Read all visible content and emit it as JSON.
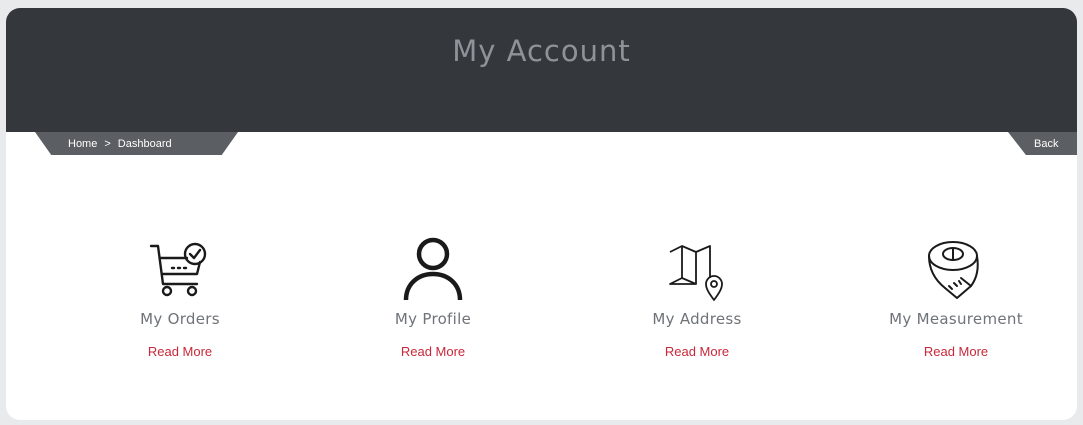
{
  "header": {
    "title": "My Account"
  },
  "breadcrumb": {
    "items": [
      "Home",
      "Dashboard"
    ],
    "separator": ">"
  },
  "nav": {
    "back_label": "Back"
  },
  "tiles": [
    {
      "label": "My Orders",
      "link": "Read More",
      "icon": "cart-check-icon"
    },
    {
      "label": "My Profile",
      "link": "Read More",
      "icon": "user-icon"
    },
    {
      "label": "My Address",
      "link": "Read More",
      "icon": "map-pin-icon"
    },
    {
      "label": "My Measurement",
      "link": "Read More",
      "icon": "measuring-tape-icon"
    }
  ],
  "colors": {
    "header_bg": "#34373c",
    "tab_bg": "#5b5e62",
    "link": "#c8283a",
    "label": "#6f7378"
  }
}
